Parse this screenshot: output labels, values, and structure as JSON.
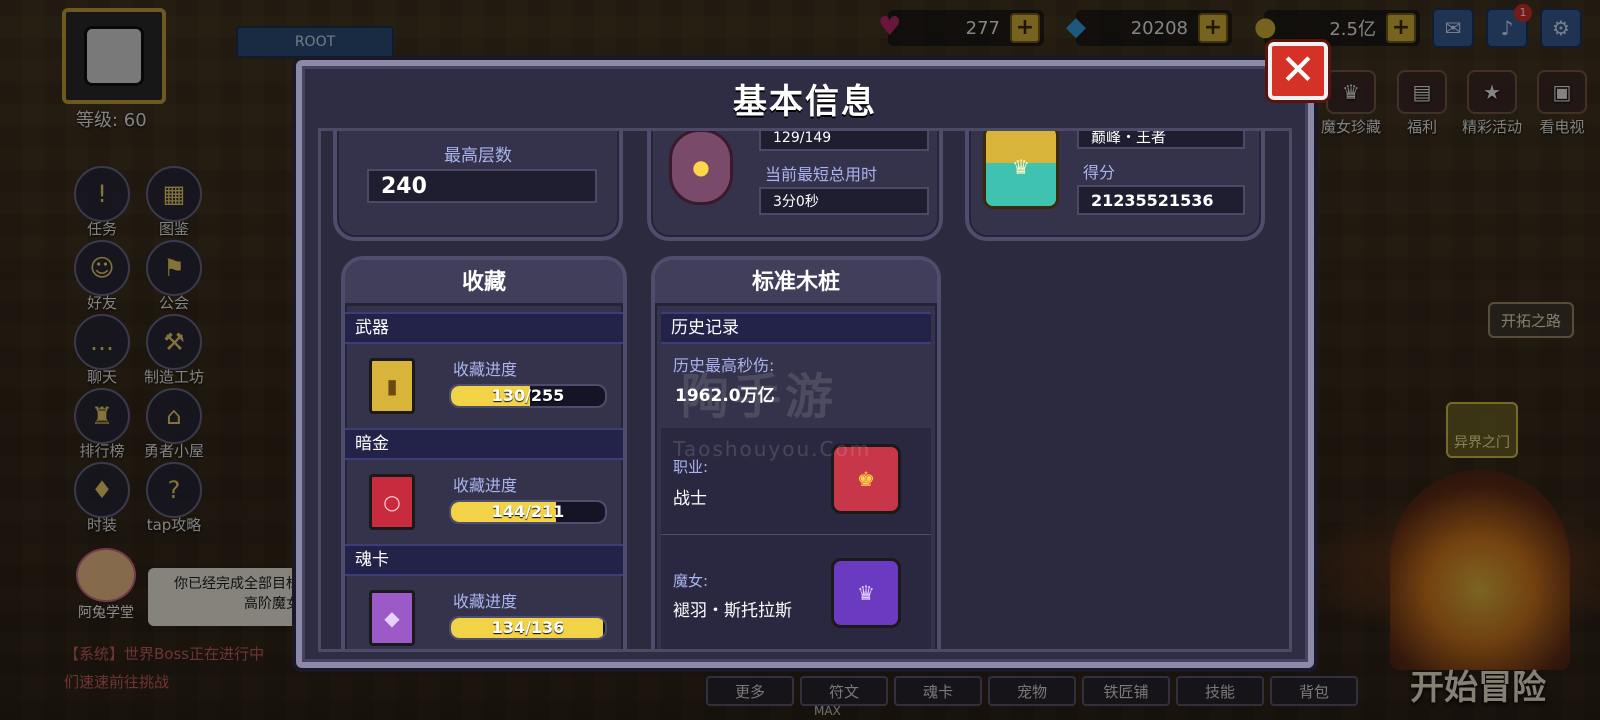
{
  "player": {
    "level_text": "等级: 60",
    "server_tag": "ROOT"
  },
  "currencies": [
    {
      "name": "heart-gem",
      "value": "277",
      "icon": "♥",
      "color": "#c0286a"
    },
    {
      "name": "diamond",
      "value": "20208",
      "icon": "◆",
      "color": "#3aa0e8"
    },
    {
      "name": "gold",
      "value": "2.5亿",
      "icon": "●",
      "color": "#d8b53a"
    }
  ],
  "top_icons": [
    {
      "name": "mail-icon",
      "glyph": "✉"
    },
    {
      "name": "notice-icon",
      "glyph": "📣",
      "badge": "1"
    },
    {
      "name": "settings-icon",
      "glyph": "⚙"
    }
  ],
  "left_menu": [
    {
      "label": "任务",
      "glyph": "!"
    },
    {
      "label": "图鉴",
      "glyph": "▦"
    },
    {
      "label": "好友",
      "glyph": "☺"
    },
    {
      "label": "公会",
      "glyph": "⚑"
    },
    {
      "label": "聊天",
      "glyph": "…"
    },
    {
      "label": "制造工坊",
      "glyph": "⚒"
    },
    {
      "label": "排行榜",
      "glyph": "🏆"
    },
    {
      "label": "勇者小屋",
      "glyph": "⌂"
    },
    {
      "label": "时装",
      "glyph": "👕"
    },
    {
      "label": "tap攻略",
      "glyph": "?"
    }
  ],
  "right_menu": [
    {
      "label": "魔女珍藏",
      "glyph": "♛"
    },
    {
      "label": "福利",
      "glyph": "🎁"
    },
    {
      "label": "精彩活动",
      "glyph": "★"
    },
    {
      "label": "看电视",
      "glyph": "▣"
    }
  ],
  "world": {
    "explore_label": "开拓之路",
    "gate_label": "异界之门",
    "start_label": "开始冒险",
    "tutor_name": "阿兔学堂",
    "tutor_speech_line1": "你已经完成全部目标",
    "tutor_speech_line2": "高阶魔女",
    "chat_line1": "【系统】世界Boss正在进行中",
    "chat_line2": "们速速前往挑战"
  },
  "bottom_nav": [
    "更多",
    "符文",
    "魂卡",
    "宠物",
    "铁匠铺",
    "技能",
    "背包"
  ],
  "max_label": "MAX",
  "modal": {
    "title": "基本信息",
    "close_glyph": "✕",
    "tower": {
      "label": "最高层数",
      "value": "240"
    },
    "boss": {
      "top_value": "129/149",
      "label": "当前最短总用时",
      "value": "3分0秒"
    },
    "rank": {
      "rank_value": "巅峰・王者",
      "score_label": "得分",
      "score_value": "21235521536"
    },
    "collection": {
      "title": "收藏",
      "sections": [
        {
          "name": "武器",
          "progress_label": "收藏进度",
          "progress_text": "130/255",
          "current": 130,
          "total": 255,
          "color": "#d8b53a"
        },
        {
          "name": "暗金",
          "progress_label": "收藏进度",
          "progress_text": "144/211",
          "current": 144,
          "total": 211,
          "color": "#c82a3e"
        },
        {
          "name": "魂卡",
          "progress_label": "收藏进度",
          "progress_text": "134/136",
          "current": 134,
          "total": 136,
          "color": "#9b5ac8"
        }
      ]
    },
    "dummy": {
      "title": "标准木桩",
      "history_label": "历史记录",
      "best_dps_label": "历史最高秒伤:",
      "best_dps_value": "1962.0万亿",
      "class_label": "职业:",
      "class_value": "战士",
      "witch_label": "魔女:",
      "witch_value": "褪羽・斯托拉斯"
    },
    "watermark": {
      "main": "陶手游",
      "sub": "Taoshouyou.Com"
    }
  }
}
